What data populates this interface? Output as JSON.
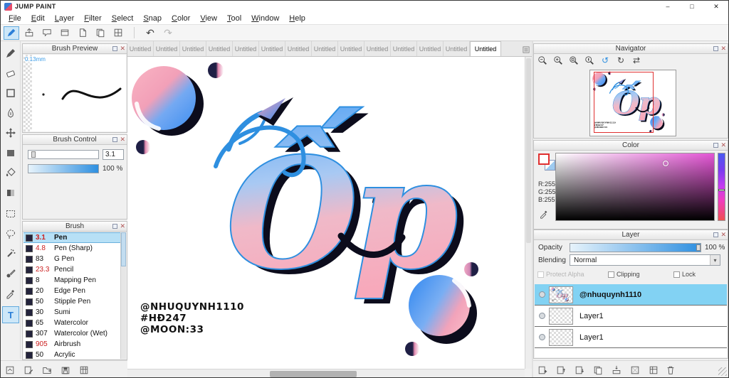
{
  "window": {
    "title": "JUMP PAINT",
    "minimize": "–",
    "maximize": "□",
    "close": "✕"
  },
  "menu": {
    "items": [
      "File",
      "Edit",
      "Layer",
      "Filter",
      "Select",
      "Snap",
      "Color",
      "View",
      "Tool",
      "Window",
      "Help"
    ]
  },
  "toolbar": {
    "undo": "↶",
    "redo": "↷"
  },
  "tabs": {
    "items": [
      "Untitled",
      "Untitled",
      "Untitled",
      "Untitled",
      "Untitled",
      "Untitled",
      "Untitled",
      "Untitled",
      "Untitled",
      "Untitled",
      "Untitled",
      "Untitled",
      "Untitled",
      "Untitled"
    ]
  },
  "brush_preview": {
    "title": "Brush Preview",
    "size_label": "0.13mm"
  },
  "brush_control": {
    "title": "Brush Control",
    "size_value": "3.1",
    "opacity_value": "100 %"
  },
  "brush": {
    "title": "Brush",
    "items": [
      {
        "size": "3.1",
        "name": "Pen"
      },
      {
        "size": "4.8",
        "name": "Pen (Sharp)"
      },
      {
        "size": "83",
        "name": "G Pen"
      },
      {
        "size": "23.3",
        "name": "Pencil"
      },
      {
        "size": "8",
        "name": "Mapping Pen"
      },
      {
        "size": "20",
        "name": "Edge Pen"
      },
      {
        "size": "50",
        "name": "Stipple Pen"
      },
      {
        "size": "30",
        "name": "Sumi"
      },
      {
        "size": "65",
        "name": "Watercolor"
      },
      {
        "size": "307",
        "name": "Watercolor (Wet)"
      },
      {
        "size": "905",
        "name": "Airbrush"
      },
      {
        "size": "50",
        "name": "Acrylic"
      }
    ]
  },
  "navigator": {
    "title": "Navigator",
    "rotate_ccw": "↺",
    "rotate_cw": "↻",
    "flip": "⇄"
  },
  "color": {
    "title": "Color",
    "r": "R:255",
    "g": "G:255",
    "b": "B:255"
  },
  "layer": {
    "title": "Layer",
    "opacity_label": "Opacity",
    "opacity_value": "100 %",
    "blending_label": "Blending",
    "blending_value": "Normal",
    "dropdown_arrow": "▾",
    "checks": [
      {
        "label": "Protect Alpha"
      },
      {
        "label": "Clipping"
      },
      {
        "label": "Lock"
      }
    ],
    "items": [
      {
        "name": "@nhuquynh1110"
      },
      {
        "name": "Layer1"
      },
      {
        "name": "Layer1"
      }
    ]
  },
  "canvas": {
    "word": "Ốp",
    "credit1": "@NHUQUYNH1110",
    "credit2": "#HĐ247",
    "credit3": "@MOON:33"
  },
  "colors": {
    "accent_blue": "#2e8fe0",
    "layer_selected": "#82d2f3",
    "brush_selected": "#b7e0f6",
    "art_pink": "#f7a8b9",
    "art_blue": "#3b8df0",
    "art_navy": "#0c0c1c",
    "picker_magenta": "#e455d5",
    "navigator_frame": "#e03030"
  }
}
